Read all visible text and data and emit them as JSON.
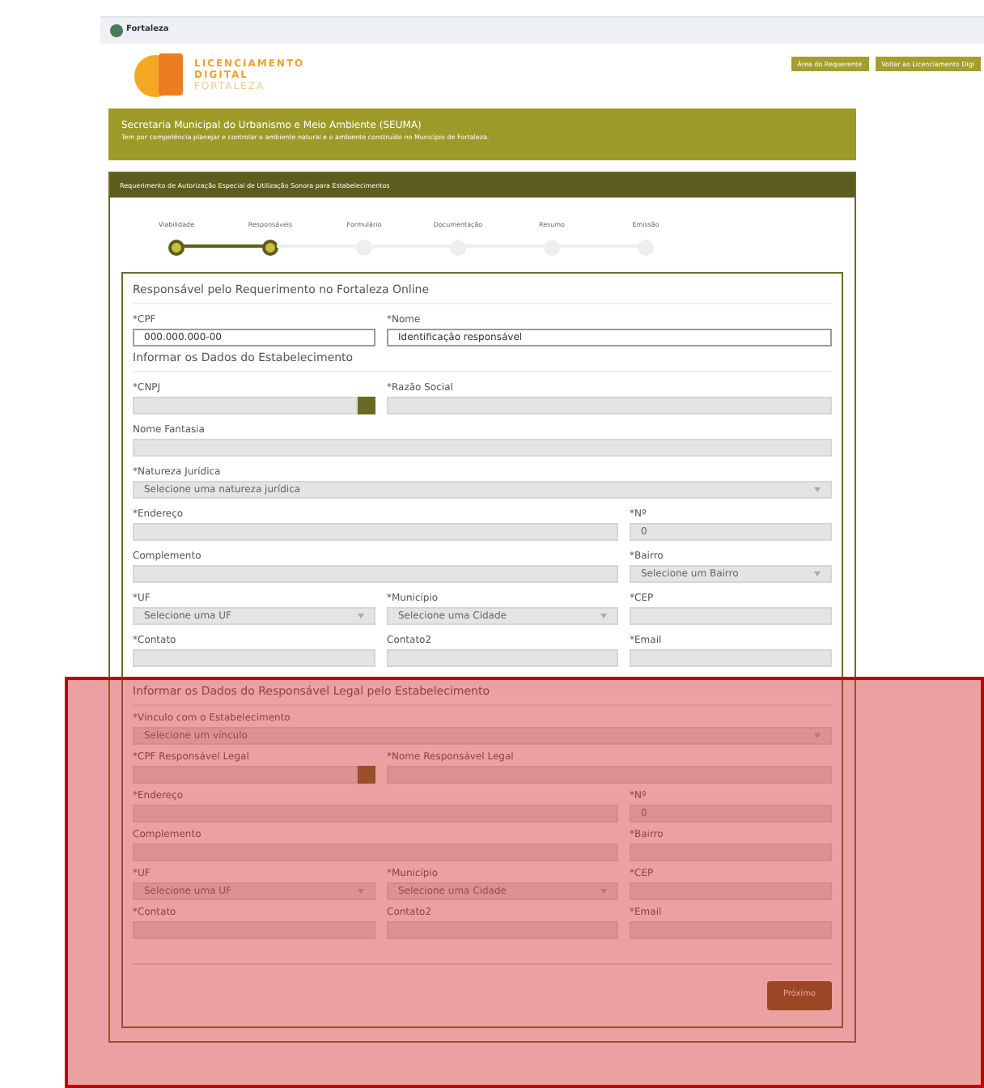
{
  "top_bar": {
    "brand": "Fortaleza"
  },
  "header": {
    "logo_lines": [
      "LICENCIAMENTO",
      "DIGITAL",
      "FORTALEZA"
    ],
    "buttons": [
      "Área do Requerente",
      "Voltar ao Licenciamento Digi"
    ]
  },
  "banner": {
    "title": "Secretaria Municipal do Urbanismo e Meio Ambiente (SEUMA)",
    "subtitle": "Tem por competência planejar e controlar o ambiente natural e o ambiente construído no Município de Fortaleza."
  },
  "panel": {
    "title": "Requerimento de Autorização Especial de Utilização Sonora para Estabelecimentos"
  },
  "steps": [
    {
      "label": "Viabilidade",
      "done": true
    },
    {
      "label": "Responsáveis",
      "done": true
    },
    {
      "label": "Formulário",
      "done": false
    },
    {
      "label": "Documentação",
      "done": false
    },
    {
      "label": "Resumo",
      "done": false
    },
    {
      "label": "Emissão",
      "done": false
    }
  ],
  "sections": [
    {
      "title": "Responsável pelo Requerimento no Fortaleza Online",
      "rows": [
        {
          "kind": "third",
          "fields": [
            {
              "label": "*CPF",
              "kind": "input",
              "value": "000.000.000-00",
              "disabled": false
            },
            {
              "label": "*Nome",
              "kind": "input",
              "value": "Identificação responsável",
              "disabled": false
            }
          ]
        }
      ]
    },
    {
      "title": "Informar os Dados do Estabelecimento",
      "rows": [
        {
          "kind": "third",
          "fields": [
            {
              "label": "*CNPJ",
              "kind": "lookup",
              "disabled": true
            },
            {
              "label": "*Razão Social",
              "kind": "input",
              "disabled": true
            }
          ]
        },
        {
          "kind": "full",
          "fields": [
            {
              "label": "Nome Fantasia",
              "kind": "input",
              "disabled": true
            }
          ]
        },
        {
          "kind": "full",
          "fields": [
            {
              "label": "*Natureza Jurídica",
              "kind": "select",
              "placeholder": "Selecione uma natureza jurídica",
              "disabled": true
            }
          ]
        },
        {
          "kind": "wide",
          "fields": [
            {
              "label": "*Endereço",
              "kind": "input",
              "disabled": true
            },
            {
              "label": "*Nº",
              "kind": "input",
              "placeholder": "0",
              "disabled": true
            }
          ]
        },
        {
          "kind": "wide",
          "fields": [
            {
              "label": "Complemento",
              "kind": "input",
              "disabled": true
            },
            {
              "label": "*Bairro",
              "kind": "select",
              "placeholder": "Selecione um Bairro",
              "disabled": true
            }
          ]
        },
        {
          "kind": "triple",
          "fields": [
            {
              "label": "*UF",
              "kind": "select",
              "placeholder": "Selecione uma UF",
              "disabled": true
            },
            {
              "label": "*Município",
              "kind": "select",
              "placeholder": "Selecione uma Cidade",
              "disabled": true
            },
            {
              "label": "*CEP",
              "kind": "input",
              "disabled": true
            }
          ]
        },
        {
          "kind": "triple",
          "fields": [
            {
              "label": "*Contato",
              "kind": "input",
              "disabled": true
            },
            {
              "label": "Contato2",
              "kind": "input",
              "disabled": true
            },
            {
              "label": "*Email",
              "kind": "input",
              "disabled": true
            }
          ]
        }
      ]
    },
    {
      "title": "Informar os Dados do Responsável Legal pelo Estabelecimento",
      "rows": [
        {
          "kind": "full",
          "fields": [
            {
              "label": "*Vínculo com o Estabelecimento",
              "kind": "select",
              "placeholder": "Selecione um vínculo",
              "disabled": true
            }
          ]
        },
        {
          "kind": "third",
          "fields": [
            {
              "label": "*CPF Responsável Legal",
              "kind": "lookup",
              "disabled": true
            },
            {
              "label": "*Nome Responsável Legal",
              "kind": "input",
              "disabled": true
            }
          ]
        },
        {
          "kind": "wide",
          "fields": [
            {
              "label": "*Endereço",
              "kind": "input",
              "disabled": true
            },
            {
              "label": "*Nº",
              "kind": "input",
              "placeholder": "0",
              "disabled": true
            }
          ]
        },
        {
          "kind": "wide",
          "fields": [
            {
              "label": "Complemento",
              "kind": "input",
              "disabled": true
            },
            {
              "label": "*Bairro",
              "kind": "input",
              "disabled": true
            }
          ]
        },
        {
          "kind": "triple",
          "fields": [
            {
              "label": "*UF",
              "kind": "select",
              "placeholder": "Selecione uma UF",
              "disabled": true
            },
            {
              "label": "*Município",
              "kind": "select",
              "placeholder": "Selecione uma Cidade",
              "disabled": true
            },
            {
              "label": "*CEP",
              "kind": "input",
              "disabled": true
            }
          ]
        },
        {
          "kind": "triple",
          "fields": [
            {
              "label": "*Contato",
              "kind": "input",
              "disabled": true
            },
            {
              "label": "Contato2",
              "kind": "input",
              "disabled": true
            },
            {
              "label": "*Email",
              "kind": "input",
              "disabled": true
            }
          ]
        }
      ]
    }
  ],
  "next_button": "Próximo"
}
